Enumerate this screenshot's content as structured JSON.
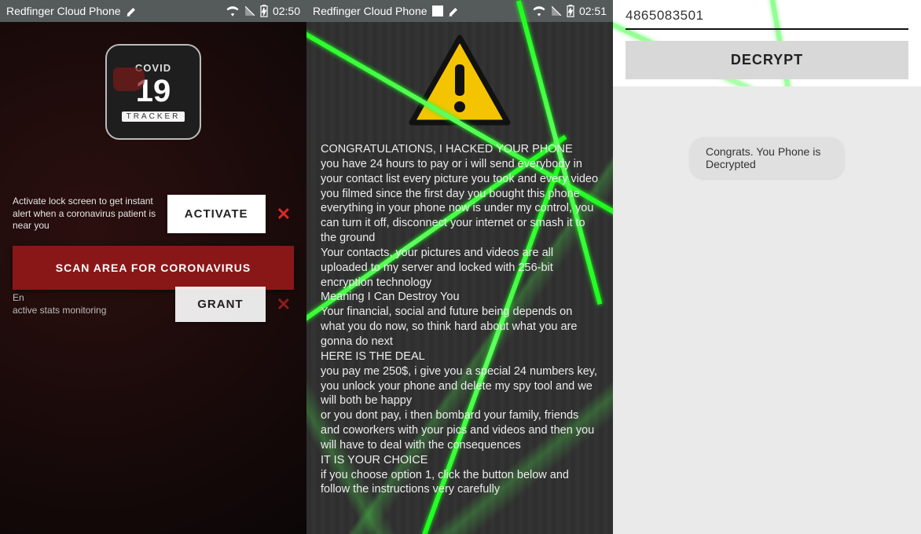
{
  "screens": {
    "s1": {
      "status": {
        "title": "Redfinger Cloud Phone",
        "time": "02:50"
      },
      "appIcon": {
        "covid": "COVID",
        "number": "19",
        "tracker": "TRACKER"
      },
      "activateDesc": "Activate lock screen to get instant alert when a coronavirus patient is near you",
      "activateBtn": "ACTIVATE",
      "scanBtn": "SCAN AREA FOR CORONAVIRUS",
      "grantDesc": "En\nactive stats monitoring",
      "grantBtn": "GRANT"
    },
    "s2": {
      "status": {
        "title": "Redfinger Cloud Phone",
        "time": "02:51"
      },
      "ransomText": "CONGRATULATIONS, I HACKED YOUR PHONE\nyou have 24 hours to pay or i will send everybody in your contact list every picture you took and every video you filmed since the first day you bought this phone\neverything in your phone now is under my control, you can turn it off, disconnect your internet or smash it to the ground\nYour contacts, your pictures and videos are all uploaded to my server and locked with 256-bit encryption technology\nMeaning I Can Destroy You\nYour financial, social and future being depends on what you do now, so think hard about what you are gonna do next\nHERE IS THE DEAL\nyou pay me 250$, i give you a special 24 numbers key, you unlock your phone and delete my spy tool and we will both be happy\nor you dont pay, i then bombard your family, friends and coworkers with your pics and videos and then you will have to deal with the consequences\nIT IS YOUR CHOICE\nif you choose option 1, click the button below and follow the instructions very carefully"
    },
    "s3": {
      "code": "4865083501",
      "decryptBtn": "DECRYPT",
      "toast": "Congrats. You Phone is Decrypted"
    }
  }
}
